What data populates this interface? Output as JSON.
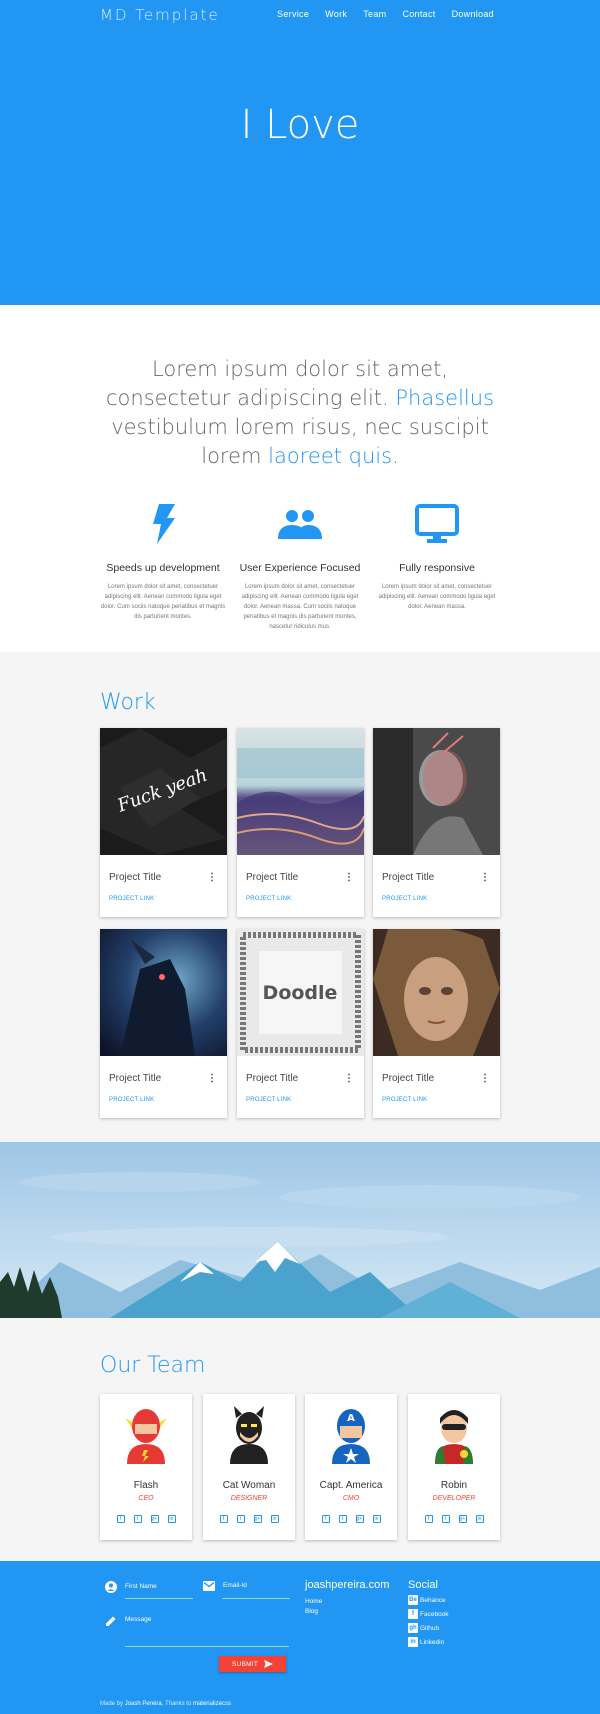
{
  "header": {
    "brand": "MD Template",
    "nav": [
      "Service",
      "Work",
      "Team",
      "Contact",
      "Download"
    ]
  },
  "hero": {
    "title": "I Love"
  },
  "intro": {
    "part1": "Lorem ipsum dolor sit amet, consectetur adipiscing elit. ",
    "highlight1": "Phasellus",
    "part2": " vestibulum lorem risus, nec suscipit lorem ",
    "highlight2": "laoreet quis",
    "part3": "."
  },
  "features": [
    {
      "icon": "bolt-icon",
      "title": "Speeds up development",
      "text": "Lorem ipsum dolor sit amet, consectetuer adipiscing elit. Aenean commodo ligula eget dolor. Cum sociis natoque penatibus et magnis dis parturient montes."
    },
    {
      "icon": "people-icon",
      "title": "User Experience Focused",
      "text": "Lorem ipsum dolor sit amet, consectetuer adipiscing elit. Aenean commodo ligula eget dolor. Aenean massa. Cum sociis natoque penatibus et magnis dis parturient montes, nascetur ridiculus mus."
    },
    {
      "icon": "monitor-icon",
      "title": "Fully responsive",
      "text": "Lorem ipsum dolor sit amet, consectetuer adipiscing elit. Aenean commodo ligula eget dolor. Aenean massa."
    }
  ],
  "work": {
    "title": "Work",
    "projects": [
      {
        "title": "Project Title",
        "link": "PROJECT LINK",
        "menu": "⋮",
        "image_text": "Fuck yeah"
      },
      {
        "title": "Project Title",
        "link": "PROJECT LINK",
        "menu": "⋮"
      },
      {
        "title": "Project Title",
        "link": "PROJECT LINK",
        "menu": "⋮"
      },
      {
        "title": "Project Title",
        "link": "PROJECT LINK",
        "menu": "⋮"
      },
      {
        "title": "Project Title",
        "link": "PROJECT LINK",
        "menu": "⋮",
        "image_text": "Doodle"
      },
      {
        "title": "Project Title",
        "link": "PROJECT LINK",
        "menu": "⋮"
      }
    ]
  },
  "team": {
    "title": "Our Team",
    "members": [
      {
        "name": "Flash",
        "role": "CEO"
      },
      {
        "name": "Cat Woman",
        "role": "DESIGNER"
      },
      {
        "name": "Capt. America",
        "role": "CMO"
      },
      {
        "name": "Robin",
        "role": "DEVELOPER"
      }
    ],
    "social_icons": [
      "f",
      "t",
      "g+",
      "in"
    ]
  },
  "footer": {
    "form": {
      "first_name_label": "First Name",
      "email_label": "Email-Id",
      "message_label": "Message",
      "submit_label": "SUBMIT"
    },
    "site": {
      "title": "joashpereira.com",
      "links": [
        "Home",
        "Blog"
      ]
    },
    "social": {
      "title": "Social",
      "links": [
        {
          "icon": "Be",
          "label": "Behance"
        },
        {
          "icon": "f",
          "label": "Facebook"
        },
        {
          "icon": "gh",
          "label": "Github"
        },
        {
          "icon": "in",
          "label": "Linkedin"
        }
      ]
    },
    "credit": {
      "prefix": "Made by ",
      "author": "Joash Pereira",
      "middle": ". Thanks to ",
      "thanks": "materializecss"
    }
  },
  "colors": {
    "primary": "#2196f3",
    "accent": "#f44336",
    "background": "#f5f5f5"
  }
}
